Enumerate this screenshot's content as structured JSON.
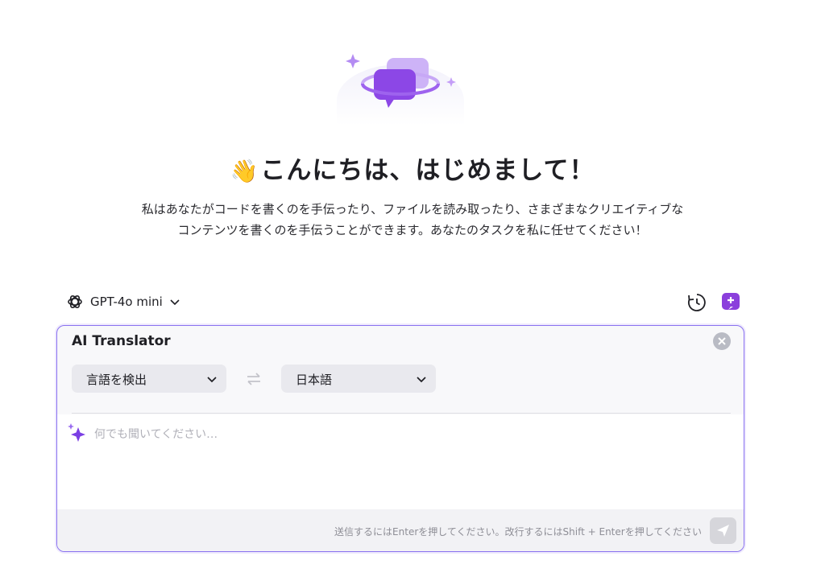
{
  "hero": {
    "wave_emoji": "👋",
    "greeting": "こんにちは、はじめまして！",
    "subtitle_line1": "私はあなたがコードを書くのを手伝ったり、ファイルを読み取ったり、さまざまなクリエイティブな",
    "subtitle_line2": "コンテンツを書くのを手伝うことができます。あなたのタスクを私に任せてください！"
  },
  "toolbar": {
    "model": "GPT-4o mini",
    "model_icon": "openai-logo-icon",
    "history_icon": "history-icon",
    "new_chat_icon": "new-chat-icon"
  },
  "panel": {
    "title": "AI Translator",
    "source_language": "言語を検出",
    "target_language": "日本語",
    "prompt_placeholder": "何でも聞いてください…",
    "hint": "送信するにはEnterを押してください。改行するにはShift + Enterを押してください"
  },
  "colors": {
    "accent": "#8b3fdc",
    "panel_border": "#8a72f0"
  }
}
